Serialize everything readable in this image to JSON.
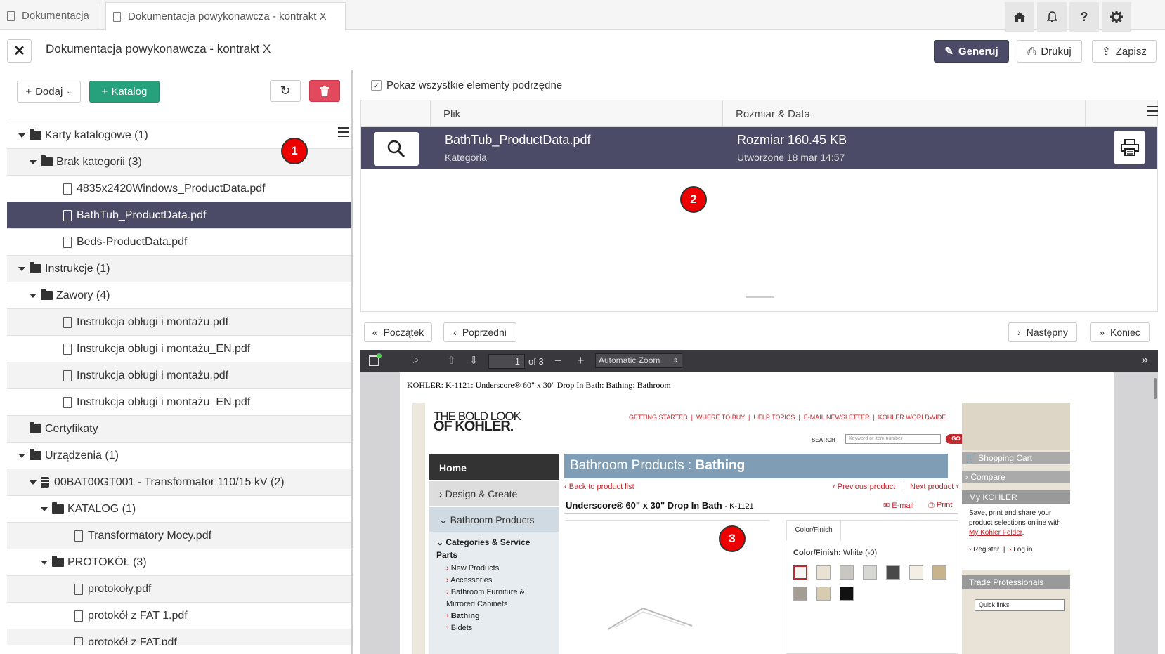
{
  "tabs": [
    {
      "label": "Dokumentacja"
    },
    {
      "label": "Dokumentacja powykonawcza - kontrakt X"
    }
  ],
  "top_icons": [
    "home-icon",
    "bell-icon",
    "help-icon",
    "gear-icon"
  ],
  "header": {
    "title": "Dokumentacja powykonawcza - kontrakt X",
    "generate": "Generuj",
    "print": "Drukuj",
    "save": "Zapisz"
  },
  "left_toolbar": {
    "add": "Dodaj",
    "catalog": "Katalog"
  },
  "tree": [
    {
      "label": "Karty katalogowe (1)",
      "type": "folder",
      "level": 0,
      "expanded": true
    },
    {
      "label": "Brak kategorii (3)",
      "type": "folder",
      "level": 1,
      "expanded": true
    },
    {
      "label": "4835x2420Windows_ProductData.pdf",
      "type": "file",
      "level": 2
    },
    {
      "label": "BathTub_ProductData.pdf",
      "type": "file",
      "level": 2,
      "selected": true
    },
    {
      "label": "Beds-ProductData.pdf",
      "type": "file",
      "level": 2
    },
    {
      "label": "Instrukcje (1)",
      "type": "folder",
      "level": 0,
      "expanded": true
    },
    {
      "label": "Zawory (4)",
      "type": "folder",
      "level": 1,
      "expanded": true
    },
    {
      "label": "Instrukcja obługi i montażu.pdf",
      "type": "file",
      "level": 2
    },
    {
      "label": "Instrukcja obługi i montażu_EN.pdf",
      "type": "file",
      "level": 2
    },
    {
      "label": "Instrukcja obługi i montażu.pdf",
      "type": "file",
      "level": 2
    },
    {
      "label": "Instrukcja obługi i montażu_EN.pdf",
      "type": "file",
      "level": 2
    },
    {
      "label": "Certyfikaty",
      "type": "folder",
      "level": 0,
      "expanded": false
    },
    {
      "label": "Urządzenia (1)",
      "type": "folder",
      "level": 0,
      "expanded": true
    },
    {
      "label": "00BAT00GT001 - Transformator 110/15 kV (2)",
      "type": "device",
      "level": 1,
      "expanded": true
    },
    {
      "label": "KATALOG (1)",
      "type": "folder",
      "level": 2,
      "expanded": true
    },
    {
      "label": "Transformatory Mocy.pdf",
      "type": "file",
      "level": 3
    },
    {
      "label": "PROTOKÓŁ (3)",
      "type": "folder",
      "level": 2,
      "expanded": true
    },
    {
      "label": "protokoły.pdf",
      "type": "file",
      "level": 3
    },
    {
      "label": "protokół z FAT 1.pdf",
      "type": "file",
      "level": 3
    },
    {
      "label": "protokół z FAT.pdf",
      "type": "file",
      "level": 3
    }
  ],
  "badges": [
    "1",
    "2",
    "3"
  ],
  "files_panel": {
    "show_all_label": "Pokaż wszystkie elementy podrzędne",
    "show_all_checked": true,
    "col_file": "Plik",
    "col_size_date": "Rozmiar & Data",
    "row": {
      "name": "BathTub_ProductData.pdf",
      "category": "Kategoria",
      "size": "Rozmiar 160.45 KB",
      "created": "Utworzone 18 mar 14:57"
    }
  },
  "nav": {
    "first": "Początek",
    "prev": "Poprzedni",
    "next": "Następny",
    "last": "Koniec"
  },
  "pdf_viewer": {
    "page": "1",
    "of": "of 3",
    "zoom": "Automatic Zoom",
    "doc_header": "KOHLER: K-1121: Underscore® 60\" x 30\" Drop In Bath: Bathing: Bathroom",
    "logo_line1": "THE BOLD LOOK",
    "logo_line2": "OF KOHLER.",
    "top_links": [
      "GETTING STARTED",
      "WHERE TO BUY",
      "HELP TOPICS",
      "E-MAIL NEWSLETTER",
      "KOHLER WORLDWIDE"
    ],
    "search_label": "SEARCH",
    "search_placeholder": "Keyword or item number",
    "go": "GO",
    "nav_home": "Home",
    "nav_design": "Design & Create",
    "nav_bathroom": "Bathroom Products",
    "cat_heading": "Categories & Service Parts",
    "cat_items": [
      "New Products",
      "Accessories",
      "Bathroom Furniture & Mirrored Cabinets",
      "Bathing",
      "Bidets"
    ],
    "banner_a": "Bathroom Products : ",
    "banner_b": "Bathing",
    "back_link": "Back to product list",
    "prev_product": "Previous product",
    "next_product": "Next product",
    "product_title": "Underscore® 60\" x 30\" Drop In Bath",
    "product_code": "- K-1121",
    "email": "E-mail",
    "print": "Print",
    "color_tab": "Color/Finish",
    "color_label": "Color/Finish:",
    "color_value": "White (-0)",
    "swatches": [
      "#f4f4f2",
      "#e9e2d2",
      "#c9c7c2",
      "#d7d7d5",
      "#4a4a4a",
      "#f3efe4",
      "#c9b38c",
      "#a39d94",
      "#d7cbb0",
      "#111111"
    ],
    "side_cart": "Shopping Cart",
    "side_compare": "Compare",
    "side_my": "My KOHLER",
    "side_my_text": "Save, print and share your product selections online with",
    "side_my_link": "My Kohler Folder",
    "side_register": "Register",
    "side_login": "Log in",
    "side_trade": "Trade Professionals",
    "side_quick": "Quick links"
  },
  "colors": {
    "accent_dark": "#4b4a67",
    "green": "#26a17b",
    "red": "#e14a5c",
    "kohler_red": "#c0282d"
  }
}
